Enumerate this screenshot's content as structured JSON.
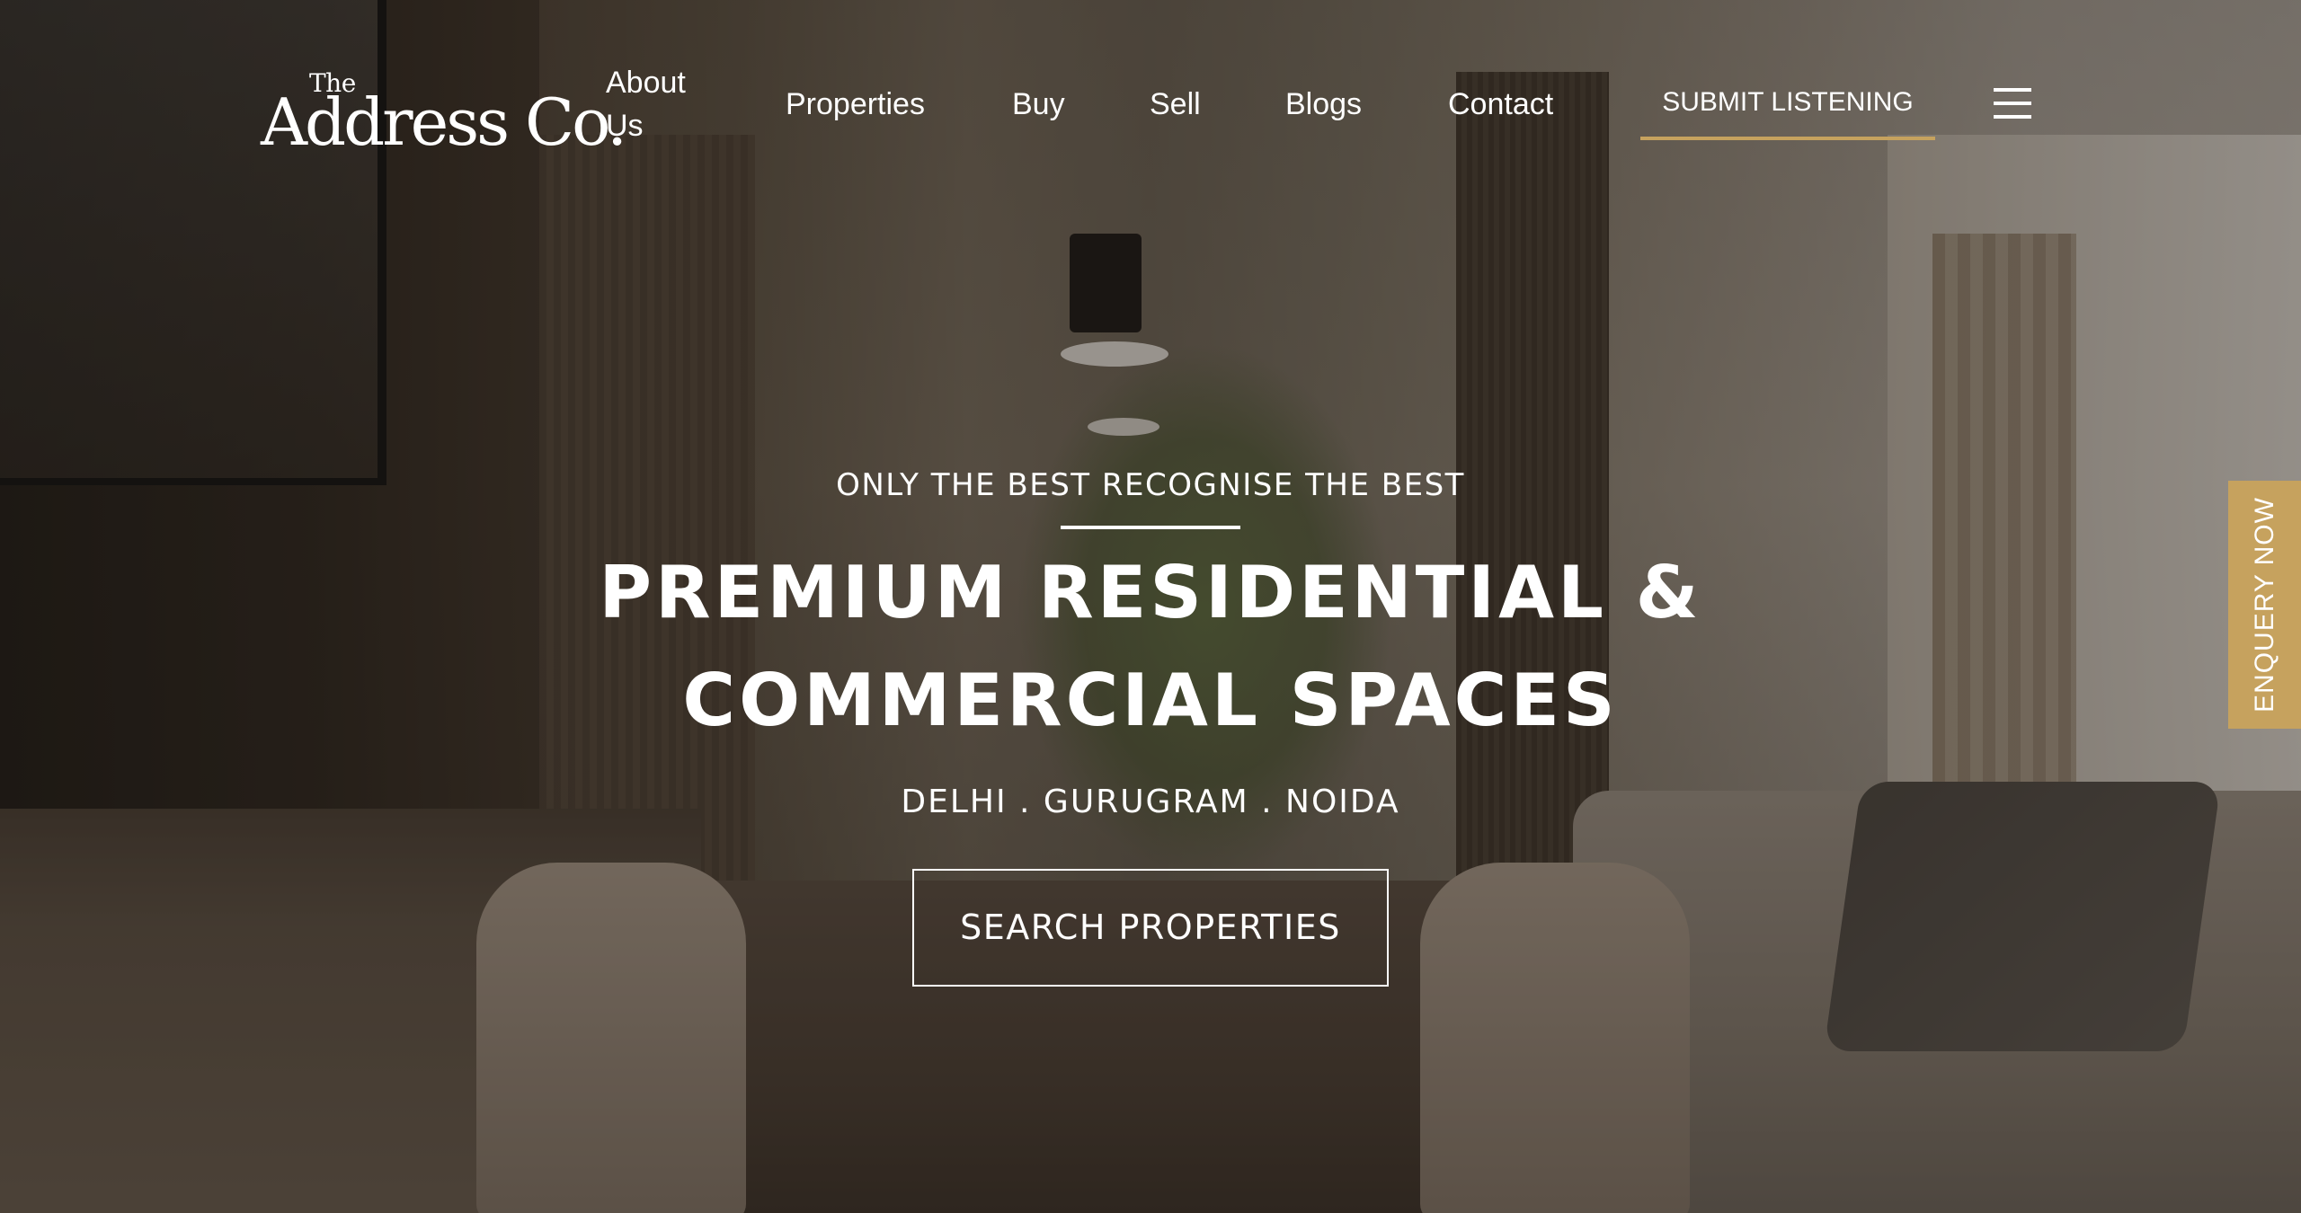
{
  "brand": {
    "logo_the": "The",
    "logo_main": "Address Co."
  },
  "nav": {
    "items": [
      "About Us",
      "Properties",
      "Buy",
      "Sell",
      "Blogs",
      "Contact"
    ],
    "submit_label": "SUBMIT LISTENING",
    "menu_icon": "hamburger-menu-icon"
  },
  "hero": {
    "tagline": "ONLY THE BEST RECOGNISE THE BEST",
    "headline_line1": "PREMIUM RESIDENTIAL &",
    "headline_line2": "COMMERCIAL SPACES",
    "cities": "DELHI . GURUGRAM . NOIDA",
    "cta_label": "SEARCH PROPERTIES"
  },
  "enquiry": {
    "label": "ENQUERY NOW"
  },
  "colors": {
    "accent_gold": "#c6a25e",
    "text": "#ffffff"
  }
}
